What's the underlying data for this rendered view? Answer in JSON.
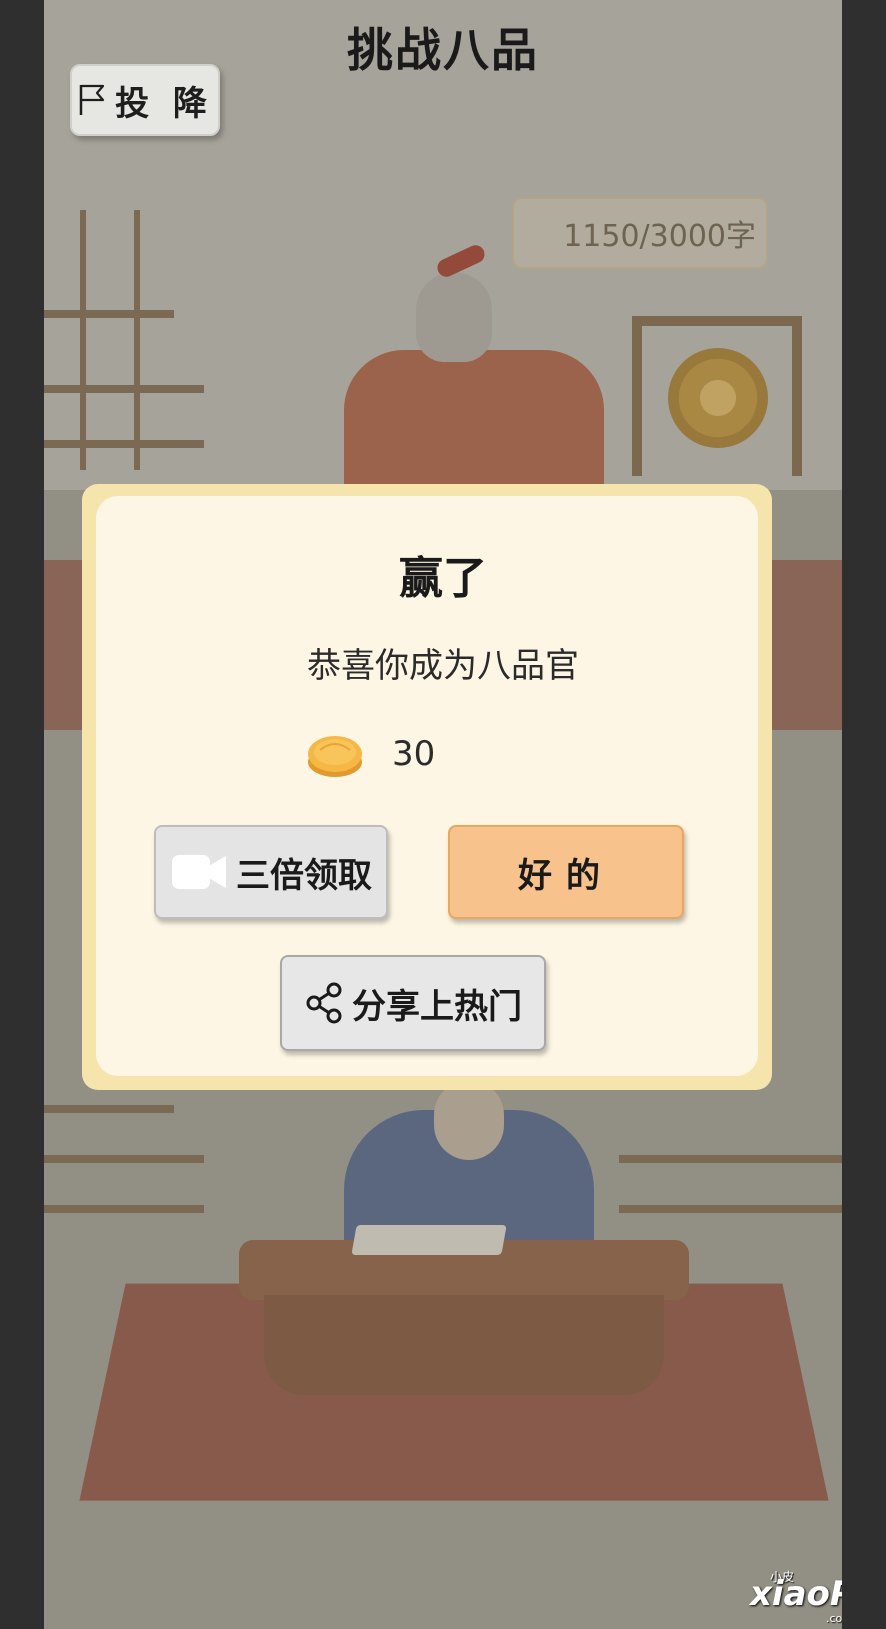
{
  "header": {
    "title": "挑战八品"
  },
  "toolbar": {
    "surrender_label": "投 降"
  },
  "progress": {
    "word_count": "1150/3000字"
  },
  "dialog": {
    "title": "赢了",
    "message": "恭喜你成为八品官",
    "reward_amount": "30",
    "triple_claim_label": "三倍领取",
    "ok_label": "好的",
    "share_label": "分享上热门"
  },
  "icons": {
    "surrender": "flag-icon",
    "coin": "coin-icon",
    "triple_claim": "video-camera-icon",
    "share": "share-icon"
  },
  "watermark": {
    "text": "xiaoPi",
    "small": "小皮",
    "domain": ".com"
  }
}
